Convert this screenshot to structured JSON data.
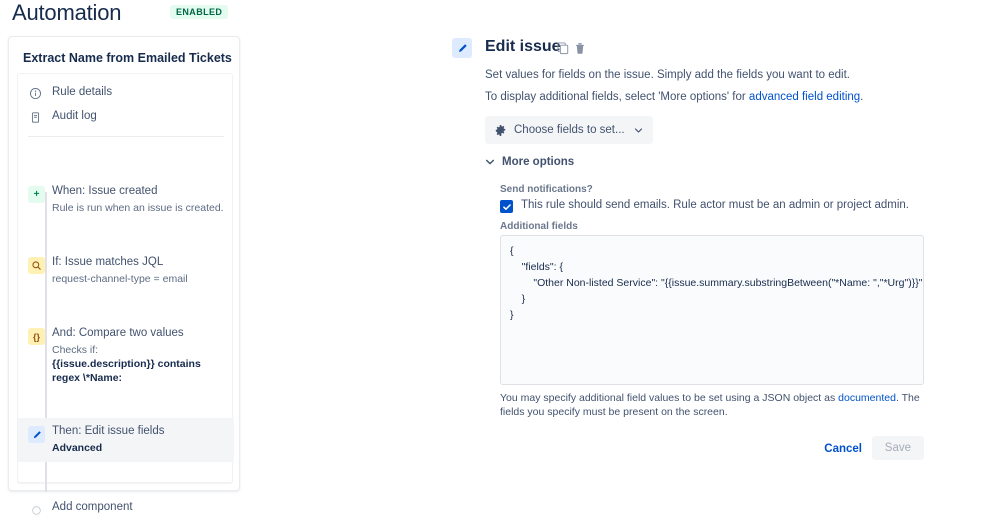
{
  "header": {
    "title": "Automation",
    "status_badge": "ENABLED",
    "badge_bg": "#e3fcef",
    "badge_fg": "#006644"
  },
  "sidebar": {
    "rule_name": "Extract Name from Emailed Tickets",
    "nav": [
      {
        "icon": "info-icon",
        "label": "Rule details"
      },
      {
        "icon": "audit-log-icon",
        "label": "Audit log"
      }
    ],
    "components": [
      {
        "kind": "trigger",
        "icon": "plus-icon",
        "icon_glyph": "+",
        "title": "When: Issue created",
        "subtitle": "Rule is run when an issue is created.",
        "selected": false
      },
      {
        "kind": "condition",
        "icon": "magnifier-icon",
        "icon_glyph": "Q",
        "title": "If: Issue matches JQL",
        "subtitle": "request-channel-type = email",
        "selected": false
      },
      {
        "kind": "condition",
        "icon": "braces-icon",
        "icon_glyph": "{}",
        "title": "And: Compare two values",
        "subtitle": "Checks if:",
        "subtitle_bold": "{{issue.description}} contains regex \\*Name:",
        "selected": false
      },
      {
        "kind": "action",
        "icon": "pencil-icon",
        "icon_glyph": "",
        "title": "Then: Edit issue fields",
        "subtitle_bold": "Advanced",
        "selected": true
      }
    ],
    "add_component": {
      "icon": "circle-outline-icon",
      "label": "Add component"
    }
  },
  "detail": {
    "icon": "pencil-icon",
    "title": "Edit issue",
    "copy_icon": "copy-icon",
    "delete_icon": "trash-icon",
    "description_1": "Set values for fields on the issue. Simply add the fields you want to edit.",
    "description_2_pre": "To display additional fields, select 'More options' for ",
    "description_2_link": "advanced field editing",
    "description_2_post": ".",
    "choose_fields_button": {
      "icon": "gear-icon",
      "label": "Choose fields to set...",
      "chevron": "chevron-down-icon"
    },
    "more_options": {
      "chevron": "chevron-down-icon",
      "label": "More options"
    },
    "send_notifications_label": "Send notifications?",
    "send_notifications_checked": true,
    "send_notifications_text": "This rule should send emails. Rule actor must be an admin or project admin.",
    "additional_fields_label": "Additional fields",
    "additional_fields_value": "{\n    \"fields\": {\n        \"Other Non-listed Service\": \"{{issue.summary.substringBetween(\"*Name: \",\"*Urg\")}}\"\n    }\n}",
    "helper_pre": "You may specify additional field values to be set using a JSON object as ",
    "helper_link": "documented",
    "helper_post": ". The fields you specify must be present on the screen.",
    "cancel_label": "Cancel",
    "save_label": "Save",
    "save_disabled": true
  },
  "colors": {
    "link": "#0052cc",
    "text": "#42526e",
    "heading": "#172b4d",
    "trigger_bg": "#e3fcef",
    "condition_bg": "#fff0b3",
    "action_bg": "#deebff"
  }
}
